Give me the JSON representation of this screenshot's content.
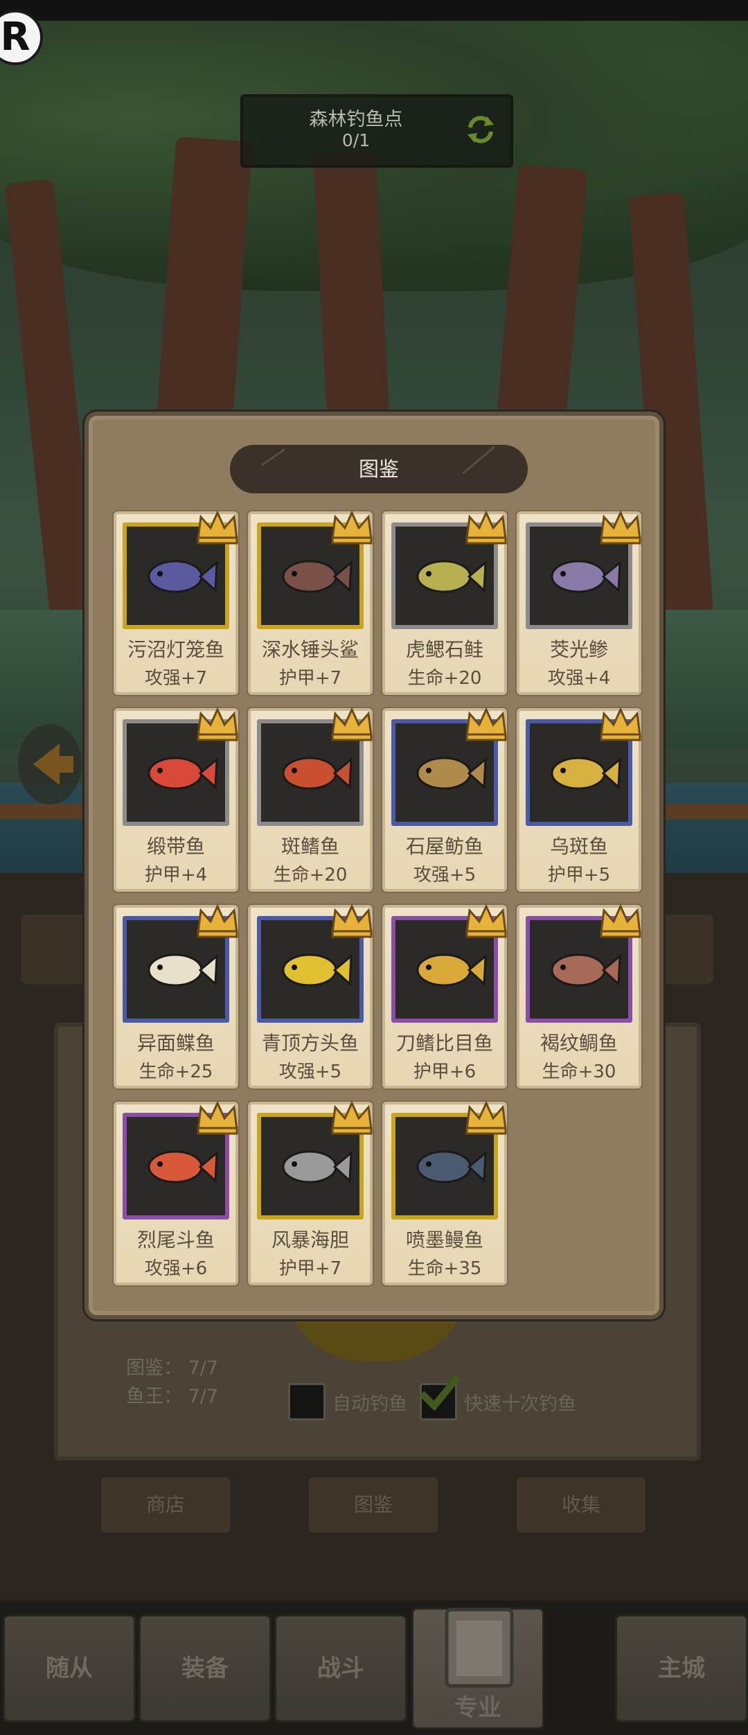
{
  "header": {
    "logo_letter": "R",
    "spot_name": "森林钓鱼点",
    "spot_count": "0/1"
  },
  "codex": {
    "title": "图鉴",
    "cards": [
      {
        "name": "污沼灯笼鱼",
        "bonus": "攻强+7",
        "rarity": "gold",
        "fish_color": "#5a5aa0"
      },
      {
        "name": "深水锤头鲨",
        "bonus": "护甲+7",
        "rarity": "gold",
        "fish_color": "#7a5048"
      },
      {
        "name": "虎鳃石鲑",
        "bonus": "生命+20",
        "rarity": "gray",
        "fish_color": "#b8b050"
      },
      {
        "name": "茭光鲹",
        "bonus": "攻强+4",
        "rarity": "gray",
        "fish_color": "#8a7aa8"
      },
      {
        "name": "缎带鱼",
        "bonus": "护甲+4",
        "rarity": "gray",
        "fish_color": "#d8493a"
      },
      {
        "name": "斑鳍鱼",
        "bonus": "生命+20",
        "rarity": "gray",
        "fish_color": "#c85030"
      },
      {
        "name": "石屋鲂鱼",
        "bonus": "攻强+5",
        "rarity": "blue",
        "fish_color": "#b08a4a"
      },
      {
        "name": "乌斑鱼",
        "bonus": "护甲+5",
        "rarity": "blue",
        "fish_color": "#d8b040"
      },
      {
        "name": "异面鲽鱼",
        "bonus": "生命+25",
        "rarity": "blue",
        "fish_color": "#e8e0c8"
      },
      {
        "name": "青顶方头鱼",
        "bonus": "攻强+5",
        "rarity": "blue",
        "fish_color": "#e0c030"
      },
      {
        "name": "刀鳍比目鱼",
        "bonus": "护甲+6",
        "rarity": "purple",
        "fish_color": "#d8a838"
      },
      {
        "name": "褐纹鲷鱼",
        "bonus": "生命+30",
        "rarity": "purple",
        "fish_color": "#a86a58"
      },
      {
        "name": "烈尾斗鱼",
        "bonus": "攻强+6",
        "rarity": "purple",
        "fish_color": "#d8583a"
      },
      {
        "name": "风暴海胆",
        "bonus": "护甲+7",
        "rarity": "gold",
        "fish_color": "#9a9a9a"
      },
      {
        "name": "喷墨鳗鱼",
        "bonus": "生命+35",
        "rarity": "gold",
        "fish_color": "#4a5a70"
      }
    ]
  },
  "background_panel": {
    "codex_stat": "图鉴： 7/7",
    "king_stat": "鱼王： 7/7",
    "auto_fish_label": "自动钓鱼",
    "quick_fish_label": "快速十次钓鱼",
    "auto_fish_checked": false,
    "quick_fish_checked": true,
    "buttons": [
      "商店",
      "图鉴",
      "收集"
    ]
  },
  "bottom_nav": {
    "tabs": [
      "随从",
      "装备",
      "战斗",
      "专业",
      "主城"
    ],
    "active": "专业"
  },
  "colors": {
    "gold": "#c7a51c",
    "gray": "#8c8c8c",
    "blue": "#4b5aa6",
    "purple": "#8a4ea8",
    "crown": "#e6b23a"
  }
}
